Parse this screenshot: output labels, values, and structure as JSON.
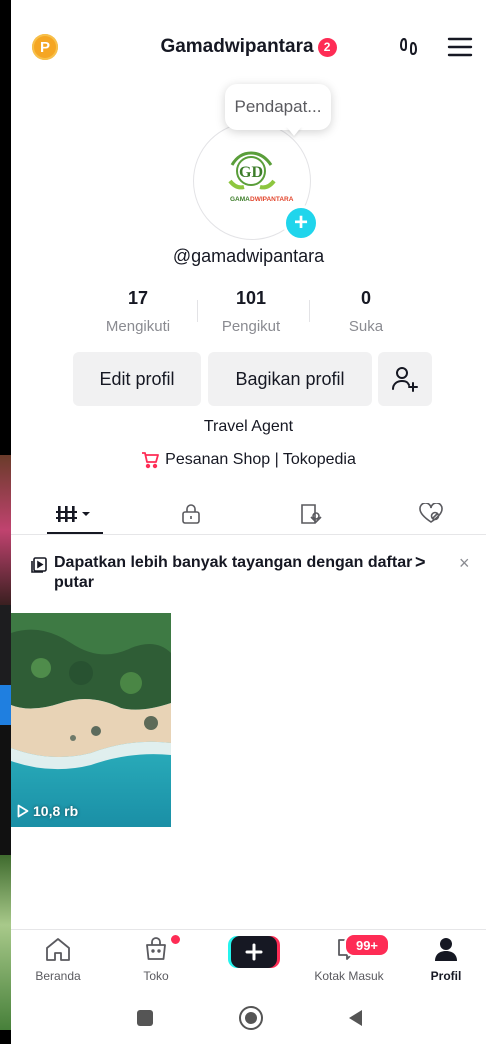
{
  "header": {
    "points_badge": "P",
    "username": "Gamadwipantara",
    "notification_count": "2",
    "footprint_icon": "footprints-icon",
    "menu_icon": "hamburger-menu-icon"
  },
  "profile": {
    "bubble_text": "Pendapat...",
    "avatar_logo_text": "GD",
    "avatar_brand_left": "GAMA",
    "avatar_brand_right": "DWIPANTARA",
    "handle": "@gamadwipantara",
    "stats": [
      {
        "value": "17",
        "label": "Mengikuti"
      },
      {
        "value": "101",
        "label": "Pengikut"
      },
      {
        "value": "0",
        "label": "Suka"
      }
    ],
    "edit_button": "Edit profil",
    "share_button": "Bagikan profil",
    "bio": "Travel Agent",
    "shop_link": "Pesanan Shop | Tokopedia"
  },
  "tabs": [
    "videos-grid-icon",
    "lock-icon",
    "tagged-icon",
    "liked-icon"
  ],
  "banner": {
    "text": "Dapatkan lebih banyak tayangan dengan daftar putar",
    "chevron": ">",
    "close": "×"
  },
  "videos": [
    {
      "views": "10,8 rb"
    }
  ],
  "bottom_nav": {
    "home": "Beranda",
    "shop": "Toko",
    "inbox": "Kotak Masuk",
    "inbox_badge": "99+",
    "profile": "Profil"
  },
  "colors": {
    "accent_red": "#fe2c55",
    "accent_cyan": "#20d5ec",
    "points_gold": "#f5a623"
  }
}
